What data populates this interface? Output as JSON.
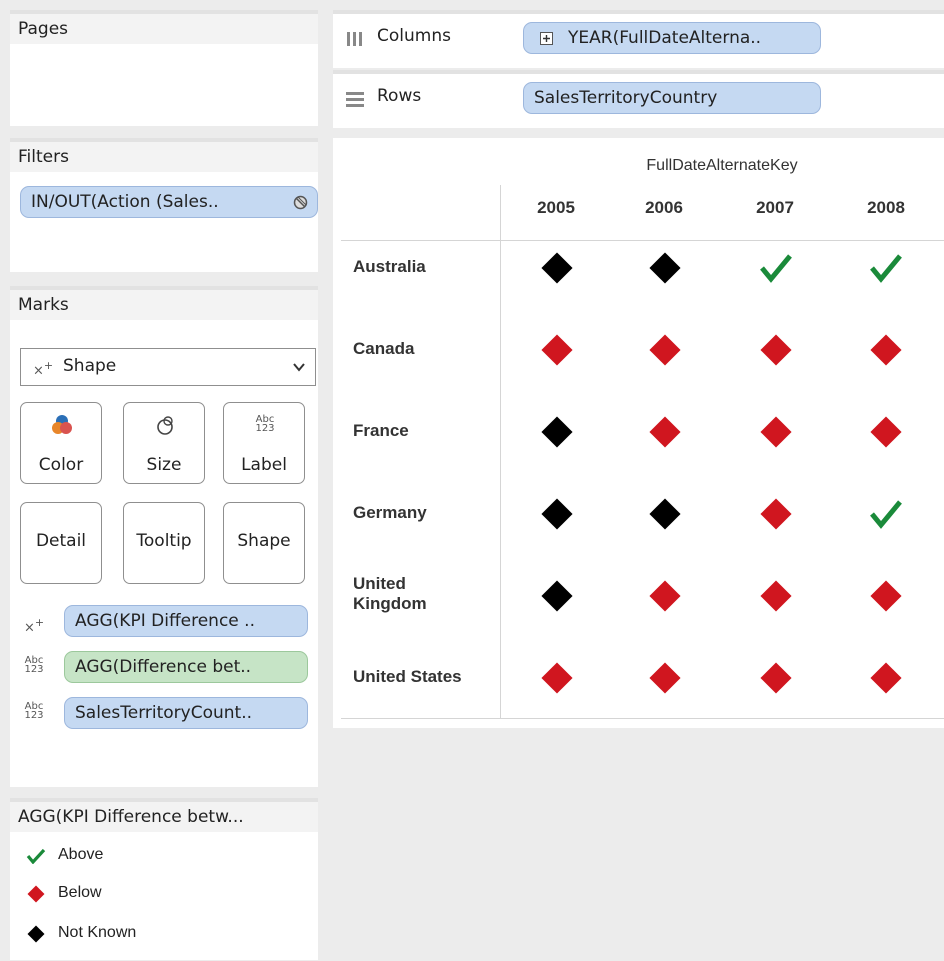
{
  "pages": {
    "title": "Pages"
  },
  "filters": {
    "title": "Filters",
    "items": [
      "IN/OUT(Action (Sales.."
    ]
  },
  "marks": {
    "title": "Marks",
    "mark_type": "Shape",
    "buttons": [
      "Color",
      "Size",
      "Label",
      "Detail",
      "Tooltip",
      "Shape"
    ],
    "label_icon_text": [
      "Abc",
      "123"
    ],
    "fields": [
      {
        "icon": "shape",
        "label": "AGG(KPI Difference .."
      },
      {
        "icon": "abc123",
        "label": "AGG(Difference bet.."
      },
      {
        "icon": "abc123",
        "label": "SalesTerritoryCount.."
      }
    ]
  },
  "legend": {
    "title": "AGG(KPI Difference betw...",
    "items": [
      {
        "label": "Above",
        "shape": "check",
        "color": "#1a8a3a"
      },
      {
        "label": "Below",
        "shape": "diamond",
        "color": "#d0161f"
      },
      {
        "label": "Not Known",
        "shape": "diamond",
        "color": "#000000"
      }
    ]
  },
  "shelves": {
    "columns_label": "Columns",
    "columns_pill": "YEAR(FullDateAlterna..",
    "rows_label": "Rows",
    "rows_pill": "SalesTerritoryCountry"
  },
  "view": {
    "column_header": "FullDateAlternateKey",
    "years": [
      "2005",
      "2006",
      "2007",
      "2008"
    ],
    "countries": [
      "Australia",
      "Canada",
      "France",
      "Germany",
      "United Kingdom",
      "United States"
    ],
    "cells": [
      [
        "Not Known",
        "Not Known",
        "Above",
        "Above"
      ],
      [
        "Below",
        "Below",
        "Below",
        "Below"
      ],
      [
        "Not Known",
        "Below",
        "Below",
        "Below"
      ],
      [
        "Not Known",
        "Not Known",
        "Below",
        "Above"
      ],
      [
        "Not Known",
        "Below",
        "Below",
        "Below"
      ],
      [
        "Below",
        "Below",
        "Below",
        "Below"
      ]
    ]
  }
}
